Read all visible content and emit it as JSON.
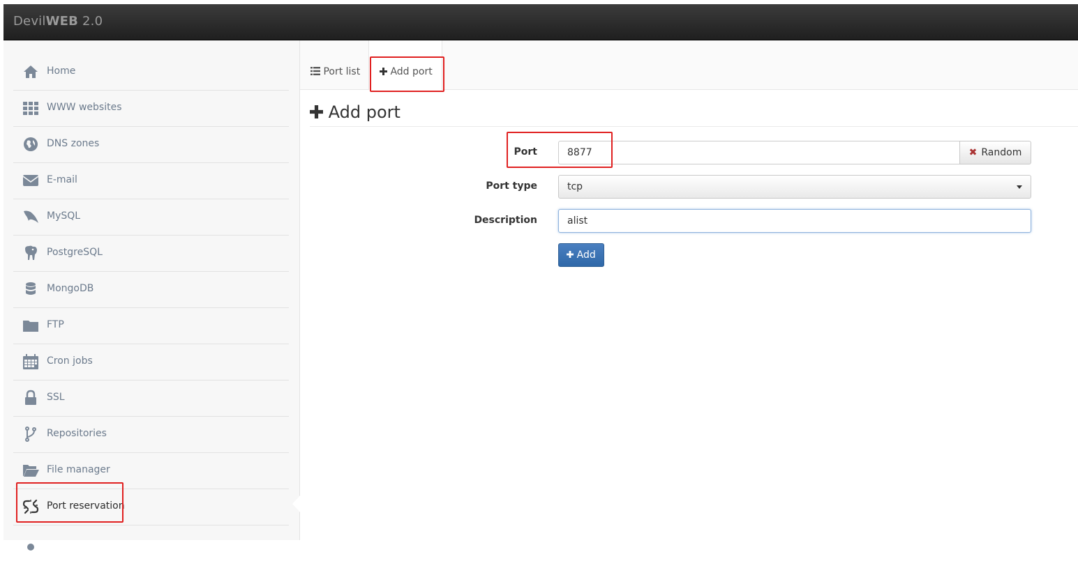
{
  "app": {
    "brand_light": "Devil",
    "brand_bold": "WEB",
    "brand_version": "2.0"
  },
  "sidebar": {
    "items": [
      {
        "label": "Home",
        "icon": "home-icon"
      },
      {
        "label": "WWW websites",
        "icon": "grid-icon"
      },
      {
        "label": "DNS zones",
        "icon": "globe-icon"
      },
      {
        "label": "E-mail",
        "icon": "envelope-icon"
      },
      {
        "label": "MySQL",
        "icon": "dolphin-icon"
      },
      {
        "label": "PostgreSQL",
        "icon": "elephant-icon"
      },
      {
        "label": "MongoDB",
        "icon": "database-icon"
      },
      {
        "label": "FTP",
        "icon": "folder-icon"
      },
      {
        "label": "Cron jobs",
        "icon": "calendar-icon"
      },
      {
        "label": "SSL",
        "icon": "lock-icon"
      },
      {
        "label": "Repositories",
        "icon": "branch-icon"
      },
      {
        "label": "File manager",
        "icon": "folder-open-icon"
      },
      {
        "label": "Port reservation",
        "icon": "broken-link-icon",
        "active": true
      }
    ]
  },
  "tabs": [
    {
      "label": "Port list",
      "icon": "list-icon"
    },
    {
      "label": "Add port",
      "icon": "plus-icon",
      "active": true
    }
  ],
  "form": {
    "title": "Add port",
    "port_label": "Port",
    "port_value": "8877",
    "random_label": "Random",
    "port_type_label": "Port type",
    "port_type_value": "tcp",
    "description_label": "Description",
    "description_value": "alist",
    "submit_label": "Add"
  },
  "colors": {
    "accent": "#3a73b3",
    "highlight": "#e02020",
    "nav_text": "#6b7a8c",
    "icon": "#7b8898"
  }
}
